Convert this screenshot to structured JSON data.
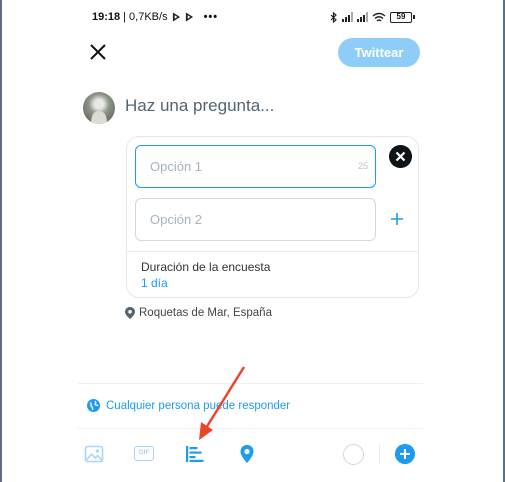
{
  "status_bar": {
    "time": "19:18",
    "network_speed": "| 0,7KB/s",
    "more": "•••",
    "battery": "59"
  },
  "compose": {
    "tweet_button": "Twittear",
    "question_placeholder": "Haz una pregunta..."
  },
  "poll": {
    "option1_placeholder": "Opción 1",
    "option1_counter": "25",
    "option2_placeholder": "Opción 2",
    "duration_label": "Duración de la encuesta",
    "duration_value": "1 día"
  },
  "location": "Roquetas de Mar, España",
  "reply_setting": "Cualquier persona puede responder",
  "toolbar": {
    "gif_label": "GIF",
    "icons": [
      "image-icon",
      "gif-icon",
      "poll-icon",
      "location-icon",
      "progress-circle",
      "add-thread-icon"
    ]
  },
  "colors": {
    "accent": "#1d9bf0",
    "tweet_button_disabled": "#8ecdf7",
    "annotation_arrow": "#e8472a"
  }
}
